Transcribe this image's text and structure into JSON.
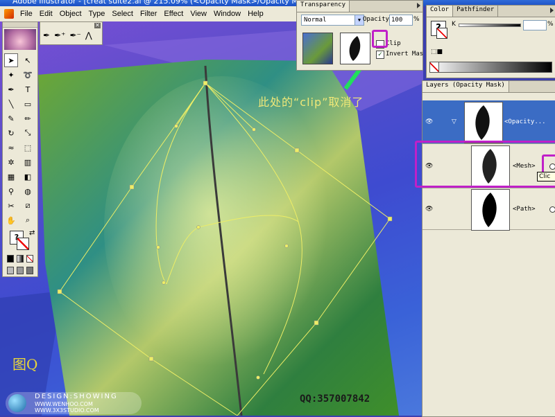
{
  "window": {
    "title": "Adobe Illustrator - [creat suite2.ai @ 215.09% (<Opacity Mask>/Opacity Ma"
  },
  "menu": [
    "File",
    "Edit",
    "Object",
    "Type",
    "Select",
    "Filter",
    "Effect",
    "View",
    "Window",
    "Help"
  ],
  "tools": [
    "selection",
    "direct-selection",
    "magic-wand",
    "lasso",
    "pen",
    "type",
    "line",
    "rectangle",
    "paintbrush",
    "pencil",
    "rotate",
    "scale",
    "warp",
    "free-transform",
    "symbol-sprayer",
    "column-graph",
    "mesh",
    "gradient",
    "eyedropper",
    "blend",
    "scissors",
    "slice",
    "hand",
    "zoom"
  ],
  "transparency": {
    "tab_label": "Transparency",
    "blend_mode": "Normal",
    "opacity_label": "Opacity",
    "opacity_value": "100",
    "percent": "%",
    "clip_label": "Clip",
    "clip_checked": false,
    "invert_label": "Invert Mas",
    "invert_checked": true,
    "checkmark": "✓"
  },
  "color": {
    "tab_color": "Color",
    "tab_pathfinder": "Pathfinder",
    "channel": "K",
    "value": "",
    "percent": "%"
  },
  "layers": {
    "tab_label": "Layers (Opacity Mask)",
    "rows": [
      {
        "name": "<Opacity...",
        "selected": true
      },
      {
        "name": "<Mesh>",
        "selected": false
      },
      {
        "name": "<Path>",
        "selected": false
      }
    ],
    "tooltip": "Clic"
  },
  "annotation": {
    "text": "此处的“clip”取消了",
    "color": "#f0e878",
    "arrow_color": "#21e05a",
    "highlight_color": "#c020c8"
  },
  "figure_label": "图Q",
  "qq": "QQ:357007842",
  "watermark": {
    "line1": "DESIGN:SHOWING",
    "line2": "WWW.WENHOO.COM",
    "line3": "WWW.3X3STUDIO.COM"
  }
}
